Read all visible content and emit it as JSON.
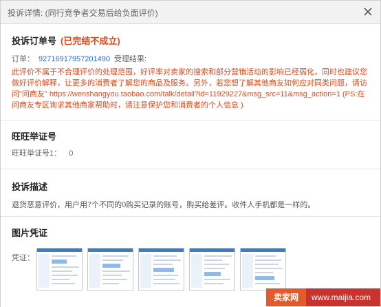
{
  "dialog": {
    "title": "投诉详情: (同行竞争者交易后给负面评价)",
    "close_icon": "close-icon"
  },
  "order_section": {
    "title": "投诉订单号",
    "status": "(已完结不成立)",
    "order_label": "订单：",
    "order_number": "92716917957201490",
    "result_label": "受理结果:",
    "notice": "此评价不属于不合理评价的处理范围，好评率对卖家的搜索和部分营销活动的影响已经弱化，同时也建议您做好评价解释，让更多的消费者了解您的商品及服务。另外，若您想了解其他商友如何应对同类问题，请访问\"问商友\" https://wenshangyou.taobao.com/talk/detail?id=11929227&msg_src=11&msg_action=1 (PS:在问商友专区询求其他商家帮助时，请注意保护您和消费者的个人信息 )"
  },
  "wangwang_section": {
    "title": "旺旺举证号",
    "item_label": "旺旺举证号1：",
    "item_value": "0"
  },
  "description_section": {
    "title": "投诉描述",
    "text": "退货恶意评价，用户用7个不同的0购买记录的账号，购买给差评。收件人手机都是一样的。"
  },
  "image_section": {
    "title": "图片凭证",
    "label": "凭证：",
    "thumbnails_count": 5
  },
  "watermark": {
    "logo": "卖家网",
    "url": "www.maijia.com",
    "colors": {
      "logo_bg": "#e35a2c",
      "bar_bg": "#c8332e"
    }
  },
  "colors": {
    "accent": "#e0481c",
    "link": "#2d6cc0",
    "titlebar": "#f2f2f2"
  }
}
